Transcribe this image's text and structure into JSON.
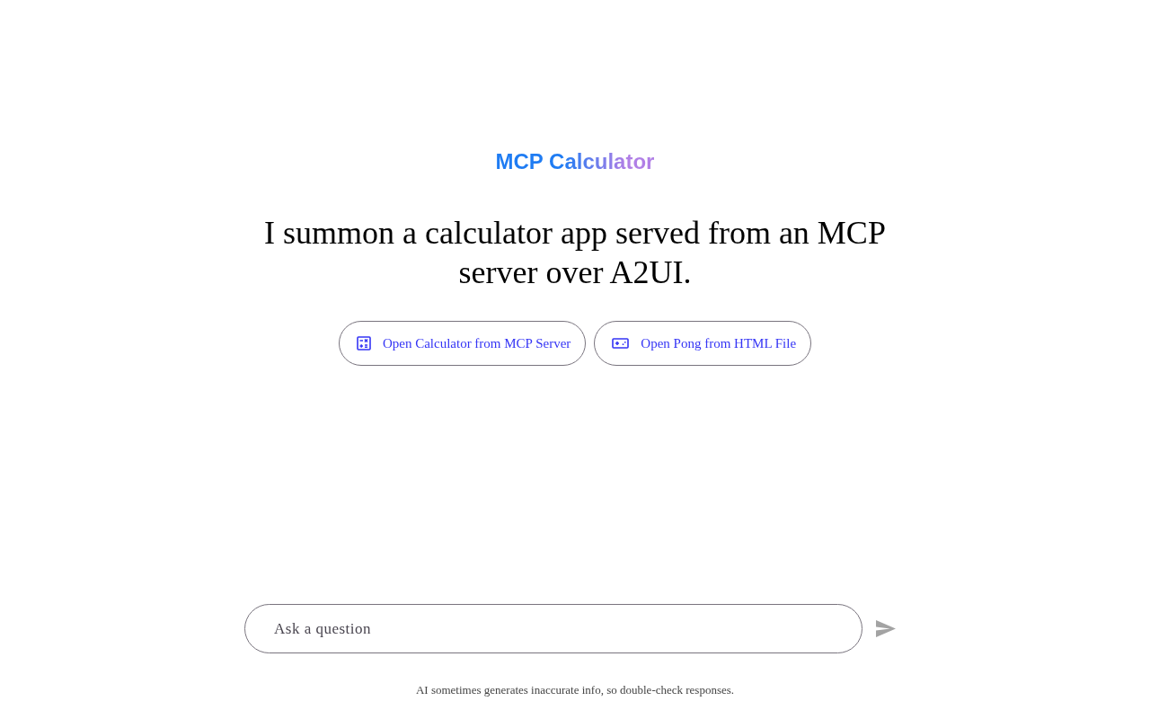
{
  "header": {
    "title": "MCP Calculator"
  },
  "prompt": "I summon a calculator app served from an MCP server over A2UI.",
  "actions": [
    {
      "kind": "calculator",
      "label": "Open Calculator from MCP Server"
    },
    {
      "kind": "game",
      "label": "Open Pong from HTML File"
    }
  ],
  "composer": {
    "placeholder": "Ask a question",
    "send_disabled": true
  },
  "disclaimer": "AI sometimes generates inaccurate info, so double-check responses."
}
